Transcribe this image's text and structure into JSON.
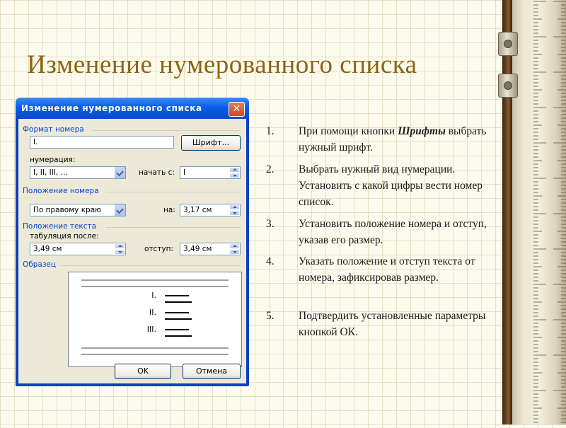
{
  "slide": {
    "title": "Изменение нумерованного списка"
  },
  "dialog": {
    "title": "Изменение нумерованного списка",
    "close_glyph": "✕",
    "number_format": {
      "group_label": "Формат номера",
      "value": "I.",
      "font_button": "Шрифт..."
    },
    "numbering": {
      "label": "нумерация:",
      "value": "I, II, III, ...",
      "start_label": "начать с:",
      "start_value": "I"
    },
    "number_position": {
      "group_label": "Положение номера",
      "value": "По правому краю",
      "at_label": "на:",
      "at_value": "3,17 см"
    },
    "text_position": {
      "group_label": "Положение текста",
      "tab_label": "табуляция после:",
      "tab_value": "3,49 см",
      "indent_label": "отступ:",
      "indent_value": "3,49 см"
    },
    "sample": {
      "group_label": "Образец",
      "numbers": [
        "I.",
        "II.",
        "III."
      ]
    },
    "ok_button": "OK",
    "cancel_button": "Отмена"
  },
  "instructions": {
    "steps": [
      {
        "num": "1.",
        "pre": "При помощи кнопки ",
        "emph": "Шрифты",
        "post": " выбрать нужный шрифт."
      },
      {
        "num": "2.",
        "pre": "Выбрать нужный вид нумерации. Установить с какой цифры вести номер список.",
        "emph": "",
        "post": ""
      },
      {
        "num": "3.",
        "pre": "Установить положение номера и отступ, указав его размер.",
        "emph": "",
        "post": ""
      },
      {
        "num": "4.",
        "pre": "Указать положение и отступ текста от номера, зафиксировав размер.",
        "emph": "",
        "post": ""
      },
      {
        "num": "5.",
        "pre": "Подтвердить установленные параметры кнопкой ОК.",
        "emph": "",
        "post": ""
      }
    ]
  },
  "colors": {
    "title_text": "#8a6512",
    "dialog_titlebar": "#0a5fe8",
    "group_label": "#0046d5"
  },
  "icons": {
    "close": "close-icon",
    "dropdown": "chevron-down-icon",
    "spinner": "spinner-arrows-icon"
  }
}
